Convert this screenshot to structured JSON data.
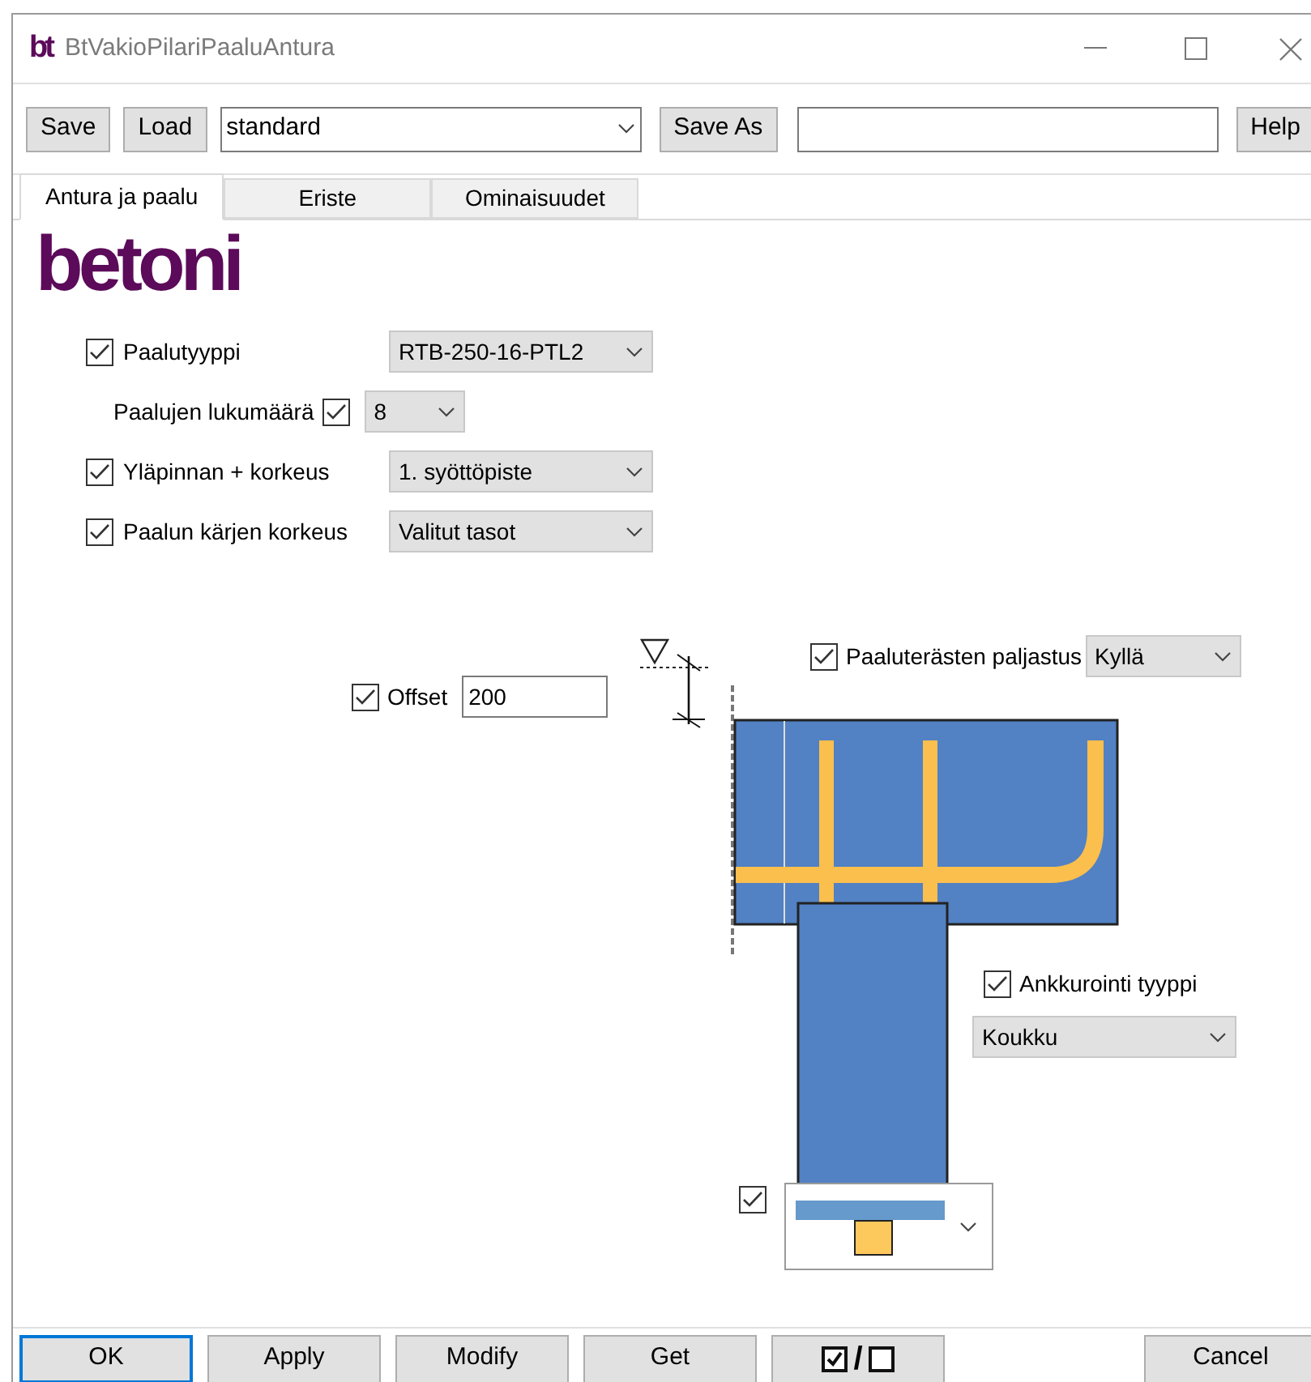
{
  "window": {
    "logo": "bt",
    "title": "BtVakioPilariPaaluAntura"
  },
  "toolbar": {
    "save": "Save",
    "load": "Load",
    "preset": "standard",
    "save_as": "Save As",
    "help": "Help"
  },
  "tabs": [
    {
      "label": "Antura ja paalu",
      "selected": true
    },
    {
      "label": "Eriste",
      "selected": false
    },
    {
      "label": "Ominaisuudet",
      "selected": false
    }
  ],
  "brand": "betoni",
  "options": [
    {
      "kind": "check-first",
      "label": "Paalutyyppi",
      "checked": true,
      "value": "RTB-250-16-PTL2"
    },
    {
      "kind": "label-first",
      "label": "Paalujen lukumäärä",
      "checked": true,
      "value": "8"
    },
    {
      "kind": "check-first",
      "label": "Yläpinnan + korkeus",
      "checked": true,
      "value": "1. syöttöpiste"
    },
    {
      "kind": "check-first",
      "label": "Paalun kärjen korkeus",
      "checked": true,
      "value": "Valitut tasot"
    }
  ],
  "diagram": {
    "offset": {
      "label": "Offset",
      "checked": true,
      "value": "200"
    },
    "exposure": {
      "label": "Paaluterästen paljastus",
      "checked": true,
      "value": "Kyllä"
    },
    "anchorage": {
      "label": "Ankkurointi tyyppi",
      "checked": true,
      "value": "Koukku"
    },
    "pile_end": {
      "checked": true
    }
  },
  "footer": [
    {
      "kind": "text",
      "label": "OK",
      "selected": true
    },
    {
      "kind": "text",
      "label": "Apply",
      "selected": false
    },
    {
      "kind": "text",
      "label": "Modify",
      "selected": false
    },
    {
      "kind": "text",
      "label": "Get",
      "selected": false
    },
    {
      "kind": "toggle",
      "label": "/",
      "selected": false
    },
    {
      "kind": "text",
      "label": "Cancel",
      "selected": false
    }
  ]
}
